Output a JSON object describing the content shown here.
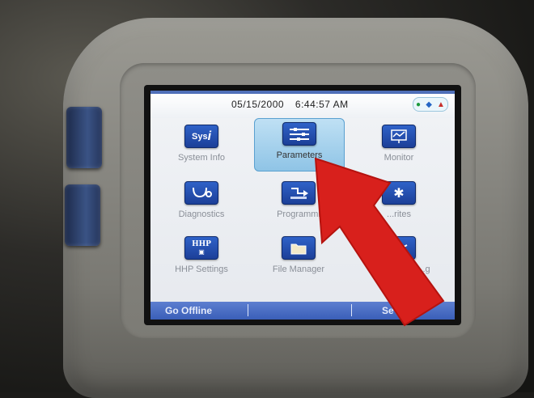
{
  "status_bar": {
    "date": "05/15/2000",
    "time": "6:44:57 AM"
  },
  "tiles": [
    {
      "label": "System Info",
      "icon": "system-info-icon",
      "glyph": "Sys"
    },
    {
      "label": "Parameters",
      "icon": "parameters-icon",
      "selected": true
    },
    {
      "label": "Monitor",
      "icon": "monitor-icon"
    },
    {
      "label": "Diagnostics",
      "icon": "stethoscope-icon"
    },
    {
      "label": "Programmi",
      "icon": "programming-icon"
    },
    {
      "label": "...rites",
      "icon": "favorites-icon"
    },
    {
      "label": "HHP Settings",
      "icon": "hhp-settings-icon",
      "glyph": "HHP"
    },
    {
      "label": "File Manager",
      "icon": "folder-icon"
    },
    {
      "label": "...g",
      "icon": "logging-icon"
    }
  ],
  "softkeys": {
    "left": "Go Offline",
    "right": "Se"
  },
  "colors": {
    "screen_accent": "#3a5fb8",
    "icon_blue": "#1c3f98",
    "selection": "#8fc4e6",
    "annotation_arrow": "#d8201c"
  }
}
